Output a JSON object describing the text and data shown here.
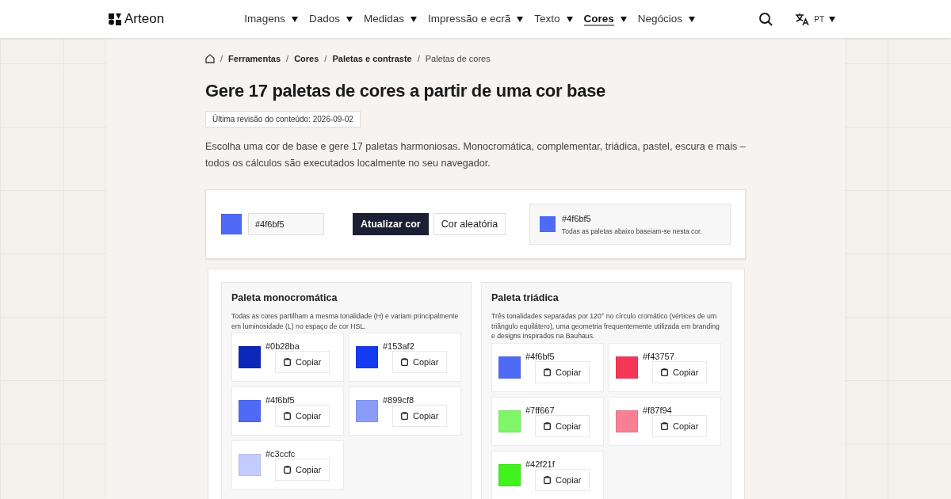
{
  "header": {
    "logo": "Arteon",
    "nav": [
      {
        "label": "Imagens",
        "selected": false
      },
      {
        "label": "Dados",
        "selected": false
      },
      {
        "label": "Medidas",
        "selected": false
      },
      {
        "label": "Impressão e ecrã",
        "selected": false
      },
      {
        "label": "Texto",
        "selected": false
      },
      {
        "label": "Cores",
        "selected": true
      },
      {
        "label": "Negócios",
        "selected": false
      }
    ],
    "language": "PT"
  },
  "breadcrumb": {
    "separator": "/",
    "items": [
      "Ferramentas",
      "Cores",
      "Paletas e contraste",
      "Paletas de cores"
    ]
  },
  "title": "Gere 17 paletas de cores a partir de uma cor base",
  "revision": "Última revisão do conteúdo: 2026-09-02",
  "intro": "Escolha uma cor de base e gere 17 paletas harmoniosas. Monocromática, complementar, triádica, pastel, escura e mais – todos os cálculos são executados localmente no seu navegador.",
  "picker": {
    "color": "#4f6bf5",
    "value": "#4f6bf5",
    "buttons": [
      {
        "label": "Atualizar cor",
        "kind": "primary"
      },
      {
        "label": "Cor aleatória",
        "kind": "secondary"
      }
    ],
    "current": {
      "color": "#4f6bf5",
      "hex": "#4f6bf5",
      "note": "Todas as paletas abaixo baseiam-se nesta cor."
    }
  },
  "palettes": [
    {
      "title": "Paleta monocromática",
      "description": "Todas as cores partilham a mesma tonalidade (H) e variam principalmente em luminosidade (L) no espaço de cor HSL.",
      "colors": [
        {
          "hex": "#0b28ba",
          "color": "#0b28ba",
          "button": "Copiar"
        },
        {
          "hex": "#153af2",
          "color": "#153af2",
          "button": "Copiar"
        },
        {
          "hex": "#4f6bf5",
          "color": "#4f6bf5",
          "button": "Copiar"
        },
        {
          "hex": "#899cf8",
          "color": "#899cf8",
          "button": "Copiar"
        },
        {
          "hex": "#c3ccfc",
          "color": "#c3ccfc",
          "button": "Copiar"
        }
      ]
    },
    {
      "title": "Paleta triádica",
      "description": "Três tonalidades separadas por 120° no círculo cromático (vértices de um triângulo equilátero), uma geometria frequentemente utilizada em branding e designs inspirados na Bauhaus.",
      "colors": [
        {
          "hex": "#4f6bf5",
          "color": "#4f6bf5",
          "button": "Copiar"
        },
        {
          "hex": "#f43757",
          "color": "#f43757",
          "button": "Copiar"
        },
        {
          "hex": "#7ff667",
          "color": "#7ff667",
          "button": "Copiar"
        },
        {
          "hex": "#f87f94",
          "color": "#f87f94",
          "button": "Copiar"
        },
        {
          "hex": "#42f21f",
          "color": "#42f21f",
          "button": "Copiar"
        }
      ]
    }
  ]
}
